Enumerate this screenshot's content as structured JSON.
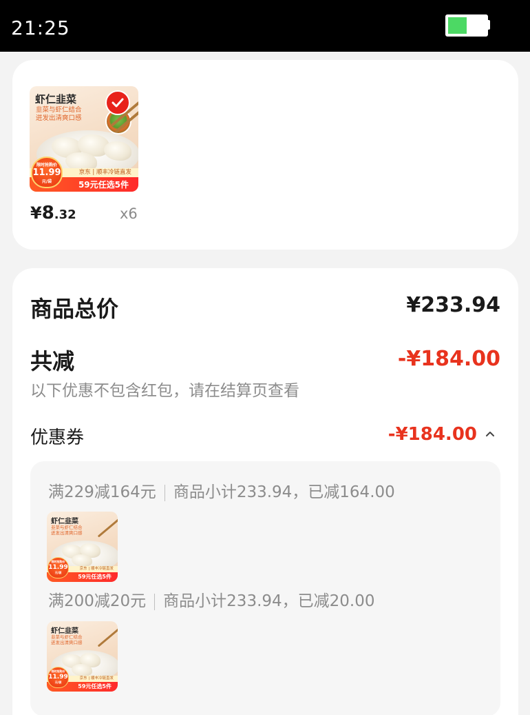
{
  "status_bar": {
    "time": "21:25",
    "battery_level": 0.5
  },
  "product": {
    "thumb": {
      "title": "虾仁韭菜",
      "subtitle_line1": "韭菜与虾仁结合",
      "subtitle_line2": "迸发出清爽口感",
      "banner_top": "京东 | 顺丰冷链直发",
      "banner_text": "59元任选5件",
      "tag_top": "限时抢购价",
      "tag_price": "11.99",
      "tag_bottom": "元/袋"
    },
    "selected": true,
    "price_symbol": "¥",
    "price_int": "8",
    "price_dec": ".32",
    "quantity": "x6"
  },
  "summary": {
    "total_label": "商品总价",
    "total_value": "¥233.94",
    "discount_label": "共减",
    "discount_value": "-¥184.00",
    "hint": "以下优惠不包含红包，请在结算页查看",
    "coupon_label": "优惠券",
    "coupon_value": "-¥184.00",
    "rules": [
      {
        "condition": "满229减164元",
        "detail": "商品小计233.94，已减164.00"
      },
      {
        "condition": "满200减20元",
        "detail": "商品小计233.94，已减20.00"
      }
    ]
  },
  "colors": {
    "accent_red": "#e8331e",
    "battery_green": "#4cd964"
  }
}
